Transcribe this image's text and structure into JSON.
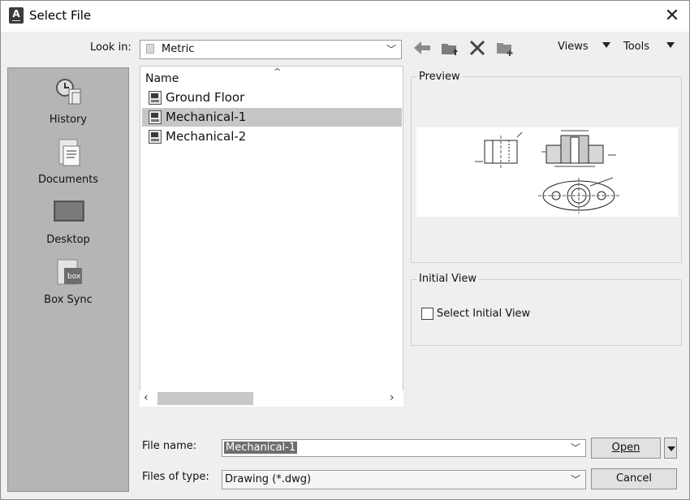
{
  "window": {
    "title": "Select File",
    "close_label": "✕"
  },
  "toolbar": {
    "look_in_label": "Look in:",
    "look_in_value": "Metric",
    "views_label": "Views",
    "tools_label": "Tools"
  },
  "places": [
    {
      "label": "History"
    },
    {
      "label": "Documents"
    },
    {
      "label": "Desktop"
    },
    {
      "label": "Box Sync"
    }
  ],
  "file_list": {
    "column_header": "Name",
    "items": [
      {
        "name": "Ground Floor",
        "selected": false
      },
      {
        "name": "Mechanical-1",
        "selected": true
      },
      {
        "name": "Mechanical-2",
        "selected": false
      }
    ]
  },
  "preview": {
    "title": "Preview"
  },
  "initial_view": {
    "title": "Initial View",
    "checkbox_label": "Select Initial View",
    "checked": false
  },
  "bottom": {
    "file_name_label": "File name:",
    "file_name_value": "Mechanical-1",
    "files_of_type_label": "Files of type:",
    "files_of_type_value": "Drawing (*.dwg)",
    "open_label": "Open",
    "cancel_label": "Cancel"
  }
}
